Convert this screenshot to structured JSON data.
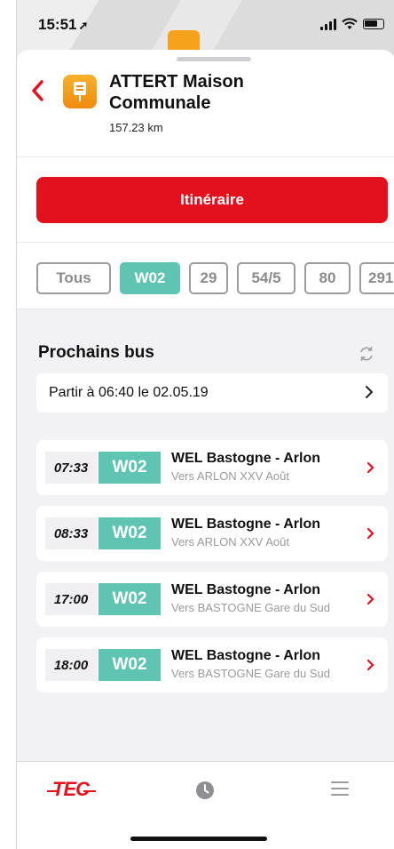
{
  "status_bar": {
    "time": "15:51",
    "location_arrow": "➚"
  },
  "header": {
    "stop_name": "ATTERT Maison Communale",
    "distance": "157.23 km"
  },
  "route_button": "Itinéraire",
  "filters": [
    "Tous",
    "W02",
    "29",
    "54/5",
    "80",
    "291"
  ],
  "active_filter": "W02",
  "next_bus": {
    "title": "Prochains bus",
    "depart_label": "Partir à 06:40 le 02.05.19"
  },
  "buses": [
    {
      "time": "07:33",
      "line": "W02",
      "title": "WEL Bastogne - Arlon",
      "direction": "Vers ARLON XXV Août"
    },
    {
      "time": "08:33",
      "line": "W02",
      "title": "WEL Bastogne - Arlon",
      "direction": "Vers ARLON XXV Août"
    },
    {
      "time": "17:00",
      "line": "W02",
      "title": "WEL Bastogne - Arlon",
      "direction": "Vers BASTOGNE Gare du Sud"
    },
    {
      "time": "18:00",
      "line": "W02",
      "title": "WEL Bastogne - Arlon",
      "direction": "Vers BASTOGNE Gare du Sud"
    }
  ],
  "tabbar": {
    "logo": "TEC"
  },
  "colors": {
    "brand_red": "#e3101e",
    "line_teal": "#5fc4b2",
    "stop_orange": "#f6a21a"
  }
}
